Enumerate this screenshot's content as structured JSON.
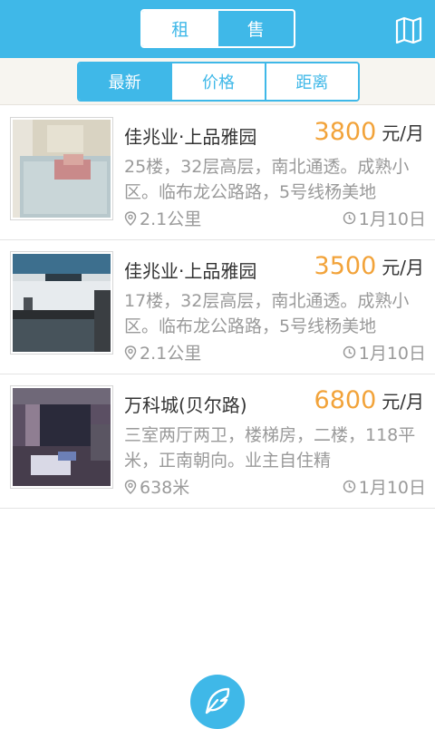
{
  "header": {
    "tabs": [
      {
        "label": "租",
        "active": true
      },
      {
        "label": "售",
        "active": false
      }
    ],
    "map_icon": "map-icon"
  },
  "sort": {
    "options": [
      {
        "label": "最新",
        "active": true
      },
      {
        "label": "价格",
        "active": false
      },
      {
        "label": "距离",
        "active": false
      }
    ]
  },
  "listings": [
    {
      "title": "佳兆业·上品雅园",
      "price": "3800",
      "unit": "元/月",
      "description": "25楼，32层高层，南北通透。成熟小区。临布龙公路路，5号线杨美地",
      "distance": "2.1公里",
      "date": "1月10日"
    },
    {
      "title": "佳兆业·上品雅园",
      "price": "3500",
      "unit": "元/月",
      "description": "17楼，32层高层，南北通透。成熟小区。临布龙公路路，5号线杨美地",
      "distance": "2.1公里",
      "date": "1月10日"
    },
    {
      "title": "万科城(贝尔路)",
      "price": "6800",
      "unit": "元/月",
      "description": "三室两厅两卫，楼梯房，二楼，118平米，正南朝向。业主自住精",
      "distance": "638米",
      "date": "1月10日"
    }
  ],
  "fab_icon": "feather-icon",
  "colors": {
    "primary": "#3fb8e8",
    "price": "#f2a33a",
    "muted": "#9a9a9a"
  }
}
